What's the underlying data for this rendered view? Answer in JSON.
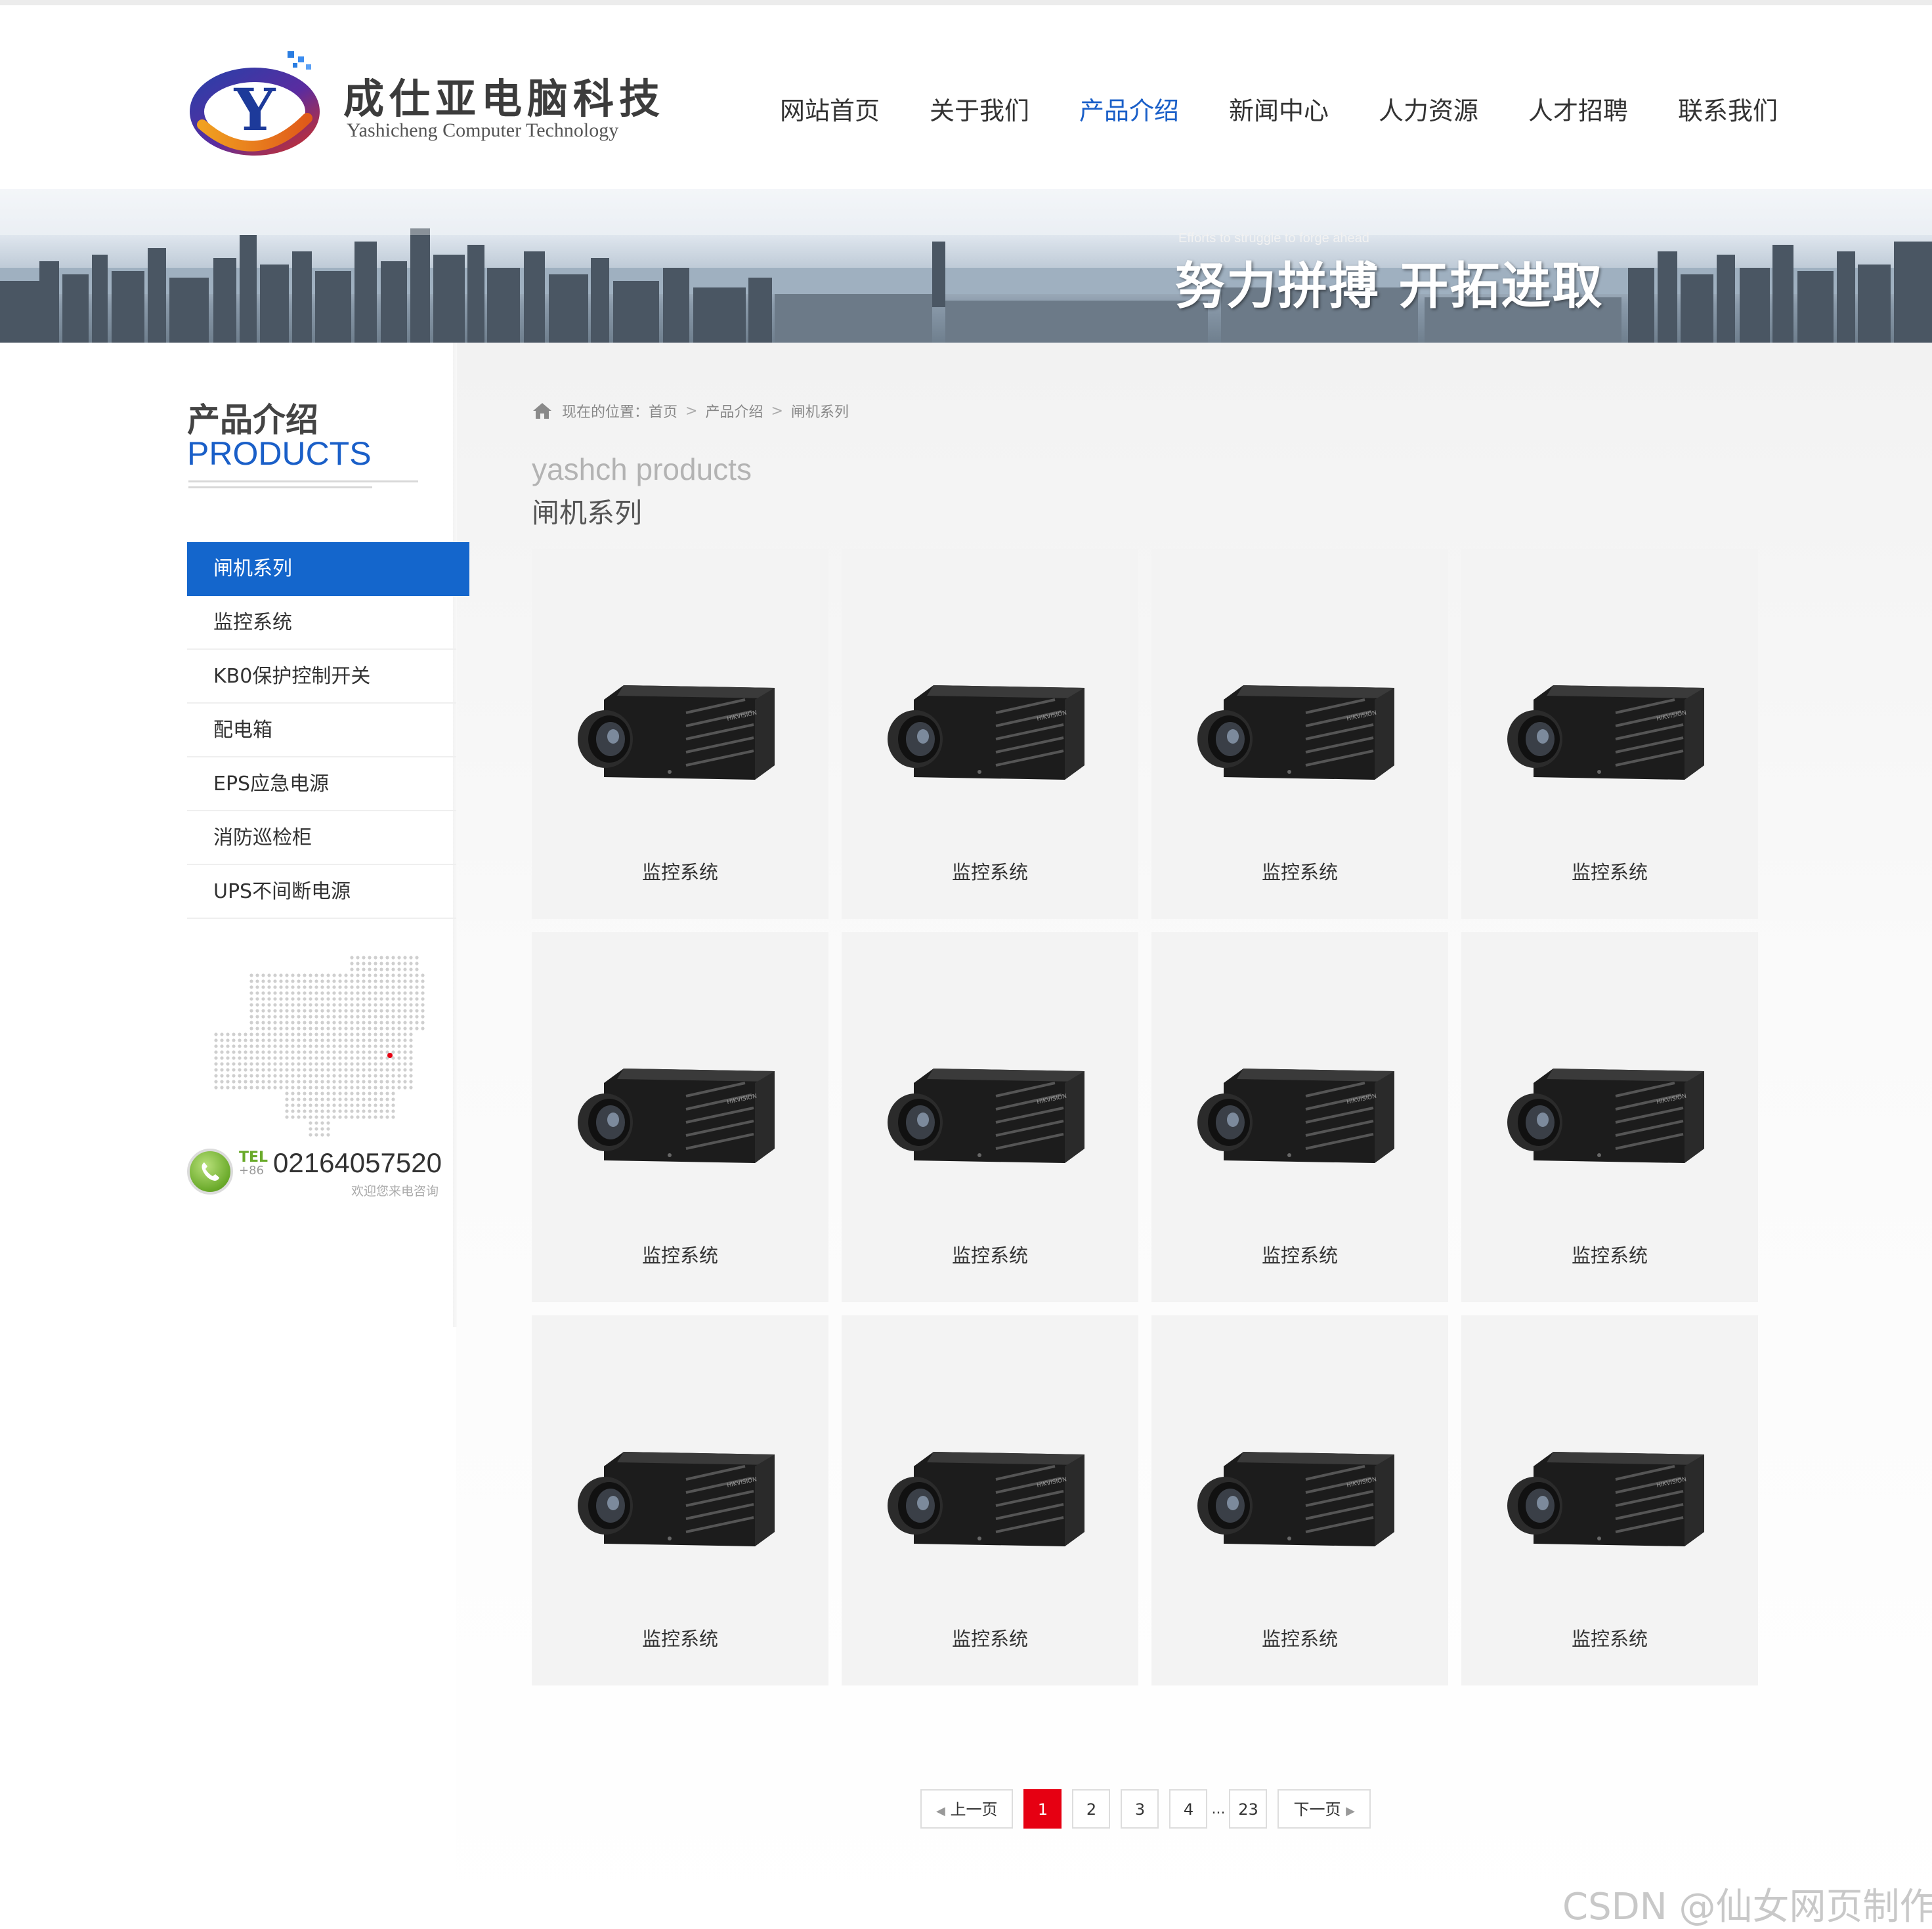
{
  "logo": {
    "cn": "成仕亚电脑科技",
    "en": "Yashicheng Computer Technology",
    "mark": "Y"
  },
  "nav": {
    "items": [
      {
        "label": "网站首页"
      },
      {
        "label": "关于我们"
      },
      {
        "label": "产品介绍"
      },
      {
        "label": "新闻中心"
      },
      {
        "label": "人力资源"
      },
      {
        "label": "人才招聘"
      },
      {
        "label": "联系我们"
      }
    ],
    "active_index": 2
  },
  "banner": {
    "subtitle": "Efforts to struggle to forge ahead",
    "title": "努力拼搏 开拓进取"
  },
  "sidebar": {
    "title_cn": "产品介绍",
    "title_en": "PRODUCTS",
    "items": [
      {
        "label": "闸机系列"
      },
      {
        "label": "监控系统"
      },
      {
        "label": "KB0保护控制开关"
      },
      {
        "label": "配电箱"
      },
      {
        "label": "EPS应急电源"
      },
      {
        "label": "消防巡检柜"
      },
      {
        "label": "UPS不间断电源"
      }
    ],
    "active_index": 0,
    "tel": {
      "label": "TEL",
      "prefix": "+86",
      "number": "02164057520",
      "note": "欢迎您来电咨询"
    }
  },
  "breadcrumb": {
    "prefix": "现在的位置：",
    "items": [
      "首页",
      "产品介绍",
      "闸机系列"
    ]
  },
  "section": {
    "en": "yashch products",
    "cn": "闸机系列"
  },
  "products": [
    {
      "name": "监控系统"
    },
    {
      "name": "监控系统"
    },
    {
      "name": "监控系统"
    },
    {
      "name": "监控系统"
    },
    {
      "name": "监控系统"
    },
    {
      "name": "监控系统"
    },
    {
      "name": "监控系统"
    },
    {
      "name": "监控系统"
    },
    {
      "name": "监控系统"
    },
    {
      "name": "监控系统"
    },
    {
      "name": "监控系统"
    },
    {
      "name": "监控系统"
    }
  ],
  "pagination": {
    "prev": "上一页",
    "next": "下一页",
    "pages": [
      "1",
      "2",
      "3",
      "4"
    ],
    "ellipsis": "...",
    "last": "23",
    "current": "1"
  },
  "watermark": "CSDN @仙女网页制作",
  "colors": {
    "accent": "#1466cc",
    "current_page": "#e60012",
    "card_bg": "#f3f3f3"
  }
}
